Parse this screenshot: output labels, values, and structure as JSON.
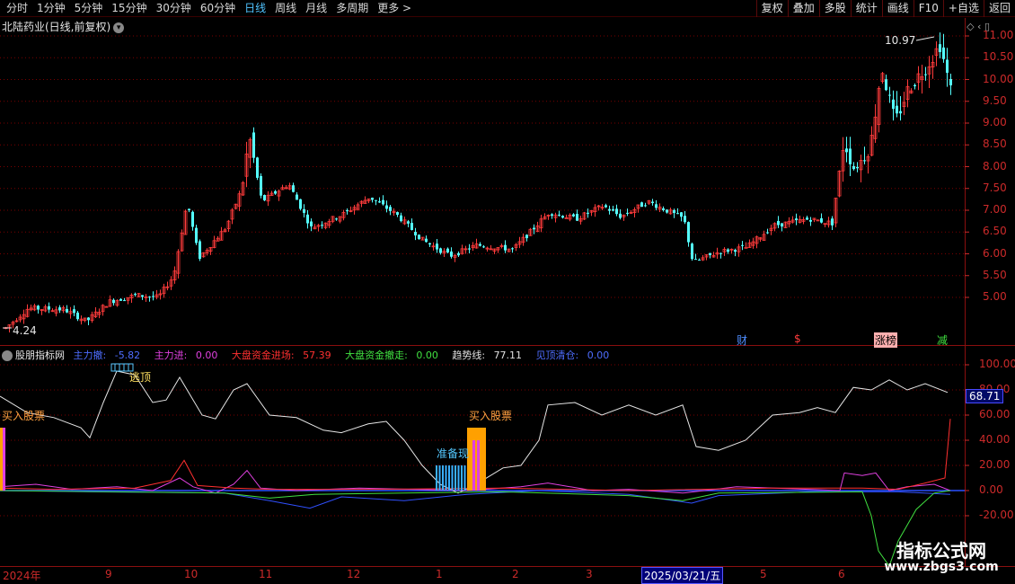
{
  "toolbar": {
    "periods": [
      "分时",
      "1分钟",
      "5分钟",
      "15分钟",
      "30分钟",
      "60分钟",
      "日线",
      "周线",
      "月线",
      "多周期",
      "更多 >"
    ],
    "active_period": "日线",
    "tools": [
      "复权",
      "叠加",
      "多股",
      "统计",
      "画线",
      "F10",
      "+自选",
      "返回"
    ]
  },
  "stock": {
    "title": "北陆药业(日线,前复权)",
    "high_label": "10.97",
    "low_label": "4.24"
  },
  "price_axis": [
    "11.00",
    "10.50",
    "10.00",
    "9.50",
    "9.00",
    "8.50",
    "8.00",
    "7.50",
    "7.00",
    "6.50",
    "6.00",
    "5.50",
    "5.00"
  ],
  "badges": [
    "财",
    "$",
    "涨榜",
    "减"
  ],
  "indicator": {
    "name": "股朋指标网",
    "items": [
      {
        "label": "主力撤:",
        "value": "-5.82",
        "color": "#4e6dff"
      },
      {
        "label": "主力进:",
        "value": "0.00",
        "color": "#e040e0"
      },
      {
        "label": "大盘资金进场:",
        "value": "57.39",
        "color": "#ff3030"
      },
      {
        "label": "大盘资金撤走:",
        "value": "0.00",
        "color": "#40e040"
      },
      {
        "label": "趋势线:",
        "value": "77.11",
        "color": "#e0e0e0"
      },
      {
        "label": "见顶清仓:",
        "value": "0.00",
        "color": "#4e6dff"
      }
    ],
    "annotations": {
      "escape": "逃顶",
      "buy1": "买入股票",
      "buy2": "买入股票",
      "prepare": "准备现"
    },
    "current_value": "68.71",
    "axis": [
      "100.00",
      "80.00",
      "60.00",
      "40.00",
      "20.00",
      "0.00",
      "-20.00"
    ]
  },
  "dates": [
    "2024年",
    "9",
    "10",
    "11",
    "12",
    "1",
    "2",
    "3",
    "2025/03/21/五",
    "5",
    "6"
  ],
  "watermark": {
    "line1": "指标公式网",
    "line2": "www.zbgs3.com"
  },
  "colors": {
    "up": "#ff3b3b",
    "down": "#54ffff",
    "grid": "#7a0000",
    "axis": "#cc2a2a"
  }
}
